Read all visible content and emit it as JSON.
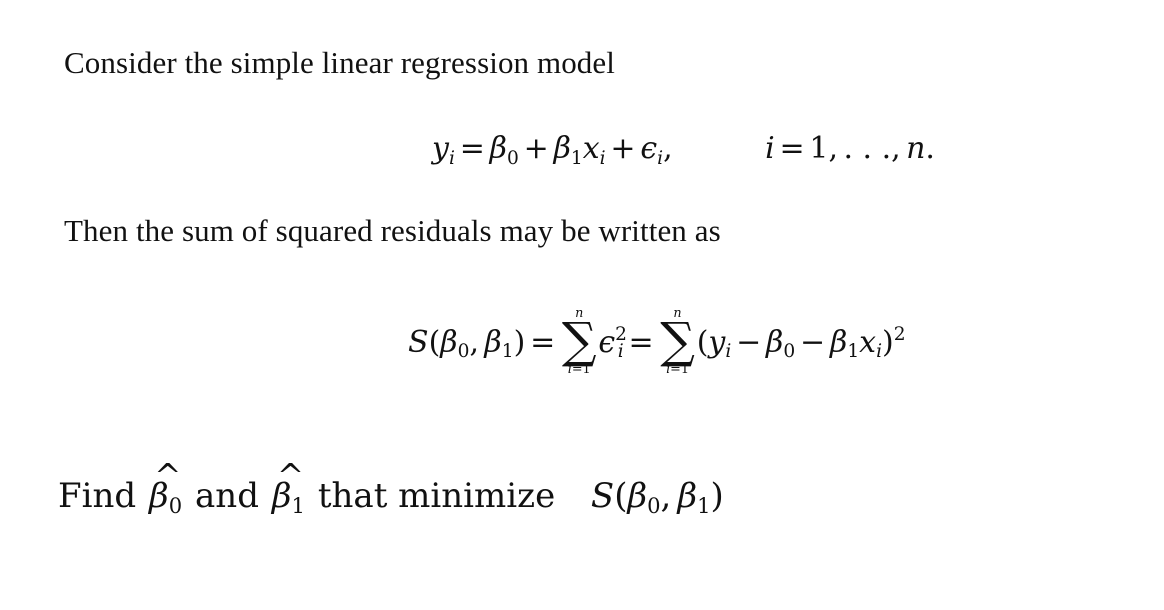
{
  "document": {
    "background_color": "#ffffff",
    "text_color": "#111111",
    "topic": "simple linear regression least squares"
  },
  "line1": {
    "text": "Consider the simple linear regression model"
  },
  "equation1": {
    "lhs_var": "y",
    "lhs_sub": "i",
    "equals": "=",
    "beta": "β",
    "beta0_sub": "0",
    "beta1_sub": "1",
    "plus": "+",
    "x_var": "x",
    "x_sub": "i",
    "epsilon": "ϵ",
    "epsilon_sub": "i",
    "comma": ",",
    "index_var": "i",
    "index_equals": "=",
    "index_start": "1",
    "index_dots": ". . .",
    "index_comma": ",",
    "index_end": "n",
    "period": ".",
    "plain": "y_i = β_0 + β_1 x_i + ϵ_i,   i = 1, . . . , n."
  },
  "line2": {
    "text": "Then the sum of squared residuals may be written as"
  },
  "equation2": {
    "S": "S",
    "lparen": "(",
    "rparen": ")",
    "beta": "β",
    "beta0_sub": "0",
    "beta1_sub": "1",
    "comma": ",",
    "equals": "=",
    "sum_glyph": "∑",
    "sum_upper": "n",
    "sum_lower_var": "i",
    "sum_lower_eq": "=",
    "sum_lower_val": "1",
    "epsilon": "ϵ",
    "epsilon_sub": "i",
    "epsilon_sup": "2",
    "y_var": "y",
    "y_sub": "i",
    "minus": "−",
    "x_var": "x",
    "x_sub": "i",
    "power": "2",
    "plain": "S(β_0, β_1) = ∑_{i=1}^{n} ϵ_i^2 = ∑_{i=1}^{n} (y_i − β_0 − β_1 x_i)^2"
  },
  "line3": {
    "find_label": "Find",
    "and_label": "and",
    "that_minimize_label": "that minimize",
    "beta": "β",
    "hat": "^",
    "beta0_sub": "0",
    "beta1_sub": "1",
    "S": "S",
    "lparen": "(",
    "rparen": ")",
    "comma": ",",
    "plain": "Find β̂_0 and β̂_1 that minimize S(β_0, β_1)"
  }
}
